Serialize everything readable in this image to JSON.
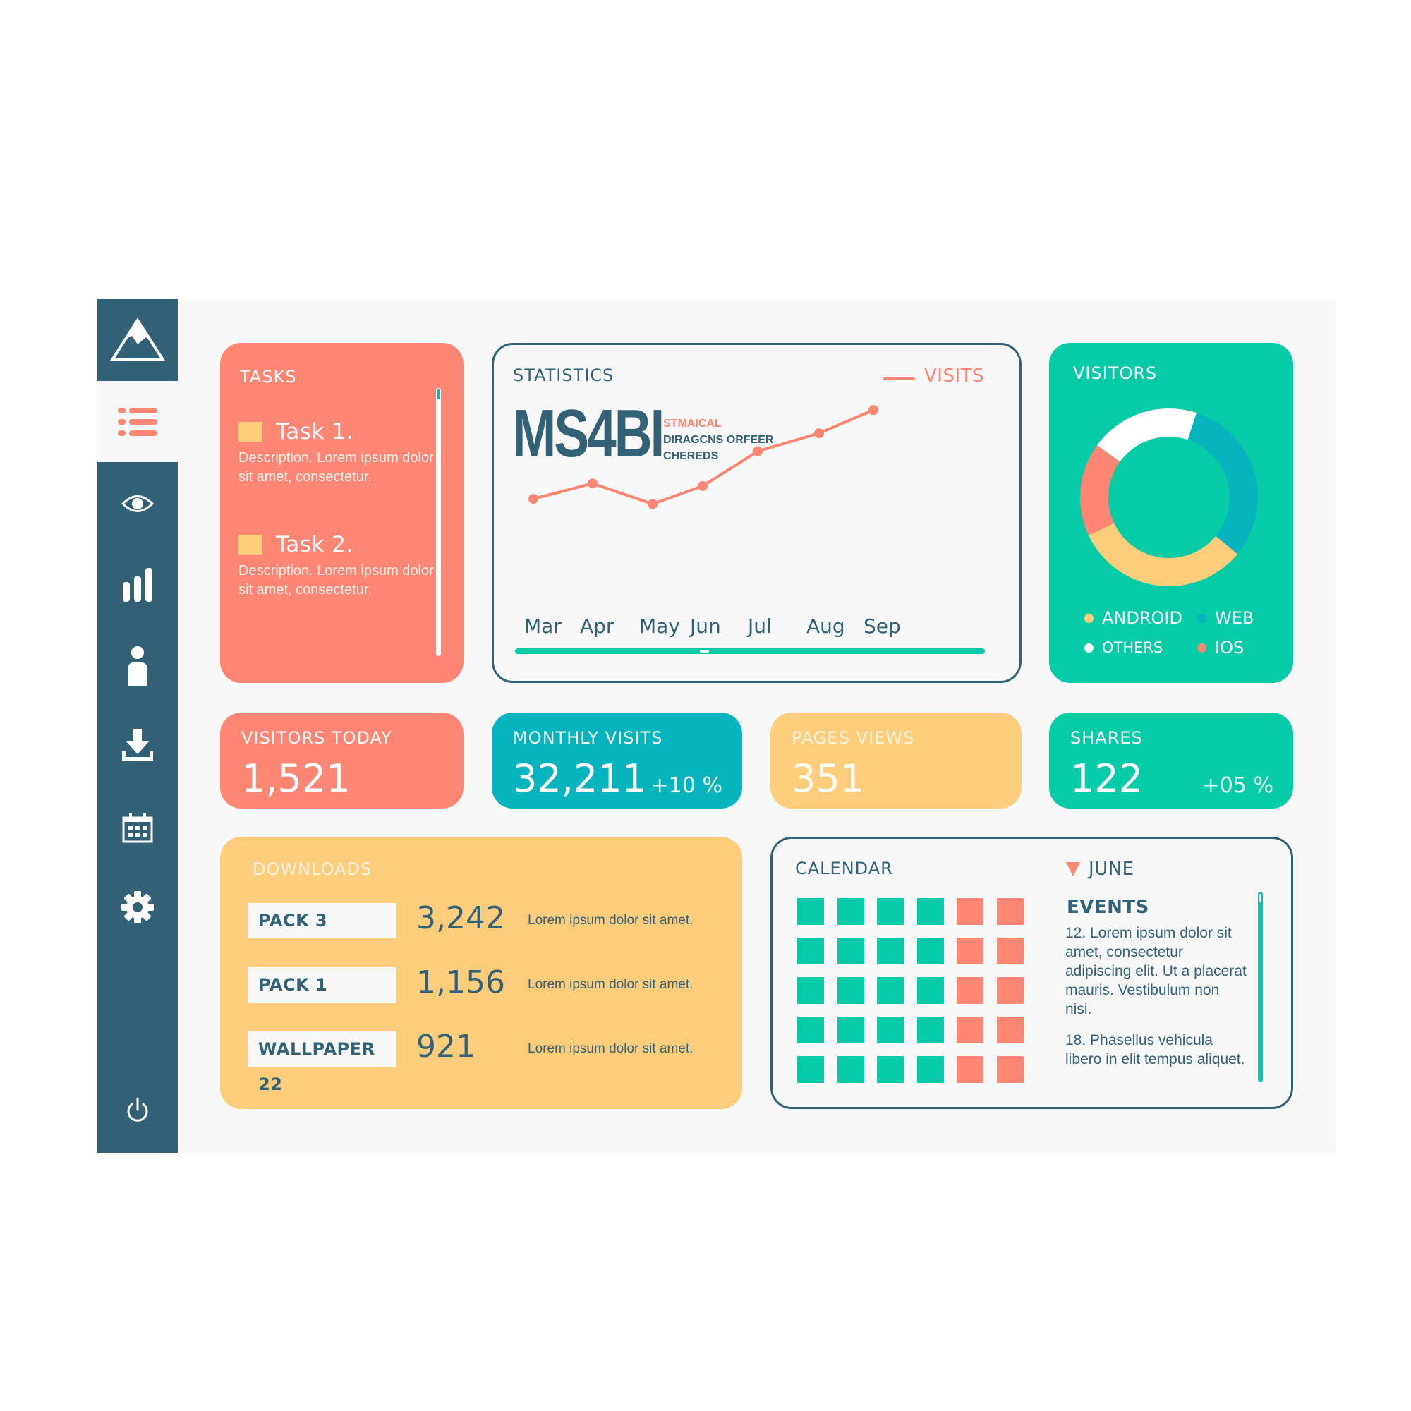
{
  "colors": {
    "navy": "#336277",
    "coral": "#fe8672",
    "teal": "#05cca6",
    "cyan": "#06b4bf",
    "yellow": "#fecd7b",
    "white": "#ffffff",
    "panel": "#f8f8f8"
  },
  "sidebar": {
    "logo_icon": "mountain-icon",
    "items": [
      {
        "icon": "list-icon",
        "active": true
      },
      {
        "icon": "eye-icon",
        "active": false
      },
      {
        "icon": "bar-chart-icon",
        "active": false
      },
      {
        "icon": "user-icon",
        "active": false
      },
      {
        "icon": "download-icon",
        "active": false
      },
      {
        "icon": "calendar-icon",
        "active": false
      },
      {
        "icon": "gear-icon",
        "active": false
      }
    ],
    "footer_icon": "power-icon"
  },
  "tasks": {
    "title": "TASKS",
    "items": [
      {
        "name": "Task 1.",
        "description": "Description. Lorem ipsum dolor sit amet, consectetur."
      },
      {
        "name": "Task 2.",
        "description": "Description. Lorem ipsum dolor sit amet, consectetur."
      }
    ]
  },
  "statistics": {
    "title": "STATISTICS",
    "brand": "MS4BI",
    "brand_sub": [
      "STMAICAL",
      "DIRAGCNS ORFEER",
      "CHEREDS"
    ]
  },
  "chart_data": {
    "type": "line",
    "title": "STATISTICS",
    "categories": [
      "Mar",
      "Apr",
      "May",
      "Jun",
      "Jul",
      "Aug",
      "Sep"
    ],
    "series": [
      {
        "name": "VISITS",
        "color": "#fe8672",
        "values": [
          12,
          24,
          8,
          22,
          49,
          63,
          81
        ]
      }
    ],
    "ylim": [
      0,
      100
    ],
    "xlabel": "",
    "ylabel": "",
    "grid": false,
    "legend": "top-right"
  },
  "visitors": {
    "title": "VISITORS",
    "donut": {
      "type": "pie",
      "start_segment": "WEB",
      "segments": [
        {
          "label": "WEB",
          "value": 31,
          "color": "#06b4bf"
        },
        {
          "label": "ANDROID",
          "value": 32,
          "color": "#fecd7b"
        },
        {
          "label": "IOS",
          "value": 17,
          "color": "#fe8672"
        },
        {
          "label": "OTHERS",
          "value": 20,
          "color": "#ffffff"
        }
      ]
    },
    "legend": [
      {
        "label": "ANDROID",
        "color": "#fecd7b"
      },
      {
        "label": "WEB",
        "color": "#06b4bf"
      },
      {
        "label": "OTHERS",
        "color": "#ffffff"
      },
      {
        "label": "IOS",
        "color": "#fe8672"
      }
    ]
  },
  "stat_cards": [
    {
      "title": "VISITORS TODAY",
      "value": "1,521",
      "delta": "",
      "color": "#fe8672"
    },
    {
      "title": "MONTHLY VISITS",
      "value": "32,211",
      "delta": "+10 %",
      "color": "#06b4bf"
    },
    {
      "title": "PAGES VIEWS",
      "value": "351",
      "delta": "",
      "color": "#fecd7b"
    },
    {
      "title": "SHARES",
      "value": "122",
      "delta": "+05 %",
      "color": "#05cca6"
    }
  ],
  "downloads": {
    "title": "DOWNLOADS",
    "rows": [
      {
        "name": "PACK  3",
        "count": "3,242",
        "description": "Lorem ipsum dolor sit amet."
      },
      {
        "name": "PACK  1",
        "count": "1,156",
        "description": "Lorem ipsum dolor sit amet."
      },
      {
        "name": "WALLPAPER 22",
        "count": "921",
        "description": "Lorem ipsum dolor sit amet."
      }
    ]
  },
  "calendar": {
    "title": "CALENDAR",
    "month": "JUNE",
    "events_title": "EVENTS",
    "events": [
      "12. Lorem ipsum dolor sit amet, consectetur adipiscing elit. Ut a placerat mauris. Vestibulum non nisi.",
      "18. Phasellus vehicula libero in elit tempus aliquet."
    ],
    "grid": {
      "rows": 5,
      "cols": 6,
      "weekday_cols": 4,
      "weekday_color": "#05cca6",
      "weekend_color": "#fe8672"
    }
  }
}
